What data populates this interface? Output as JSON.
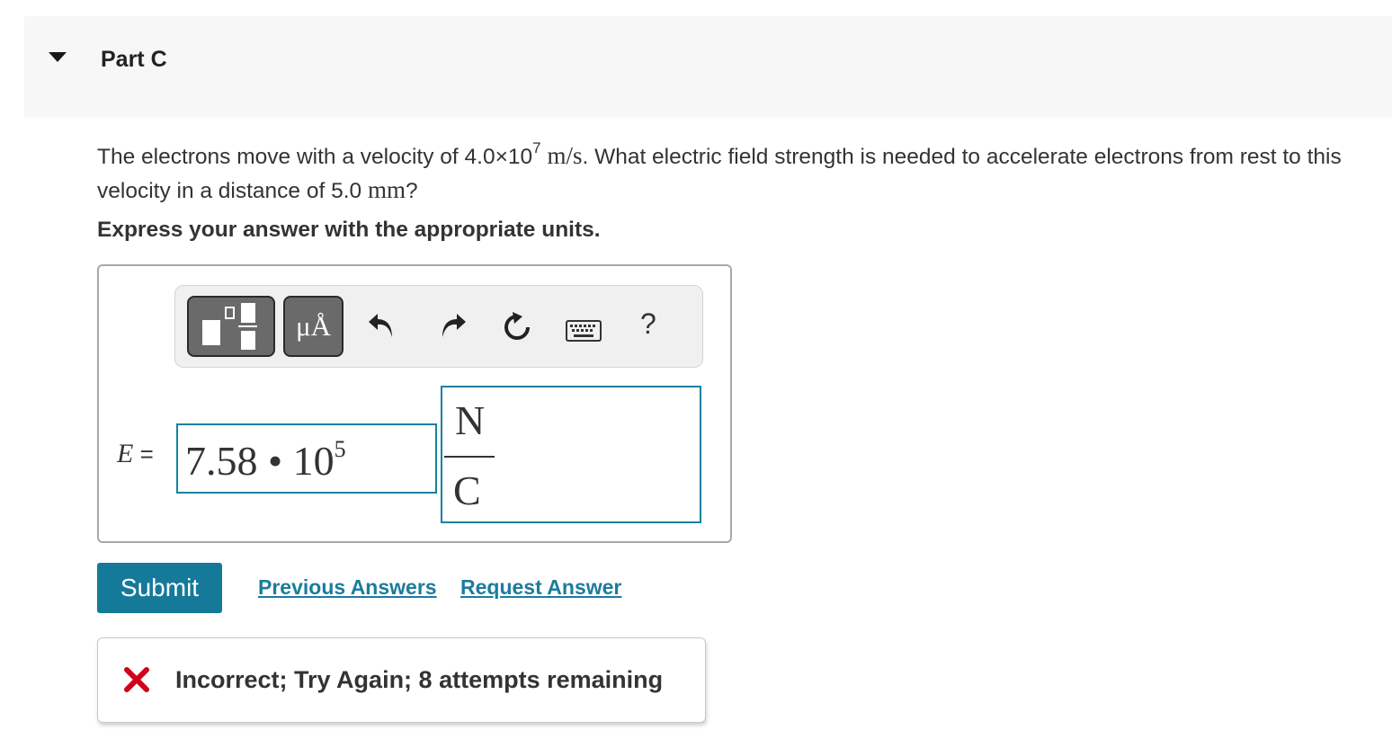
{
  "part": {
    "title": "Part C"
  },
  "question": {
    "text_1": "The electrons move with a velocity of 4.0",
    "times": "×",
    "base": "10",
    "exponent": "7",
    "unit_velocity": "m/s",
    "text_2": ". What electric field strength is needed to accelerate electrons from rest to this velocity in a distance of 5.0",
    "unit_distance": "mm",
    "text_3": "?"
  },
  "instruction": "Express your answer with the appropriate units.",
  "toolbar": {
    "units_label": "μÅ",
    "help_label": "?",
    "icons": [
      "templates-icon",
      "units-icon",
      "undo-icon",
      "redo-icon",
      "reset-icon",
      "keyboard-icon",
      "help-icon"
    ]
  },
  "answer": {
    "variable": "E",
    "equals": "=",
    "value_mantissa": "7.58",
    "value_operator": "•",
    "value_base": "10",
    "value_exponent": "5",
    "unit_numerator": "N",
    "unit_denominator": "C"
  },
  "actions": {
    "submit_label": "Submit",
    "previous_answers_label": "Previous Answers",
    "request_answer_label": "Request Answer"
  },
  "feedback": {
    "message": "Incorrect; Try Again; 8 attempts remaining",
    "status_color": "#d0021b",
    "icon": "x-icon"
  },
  "colors": {
    "accent": "#157a9a",
    "link": "#1c7c9c",
    "input_border": "#13829f"
  }
}
